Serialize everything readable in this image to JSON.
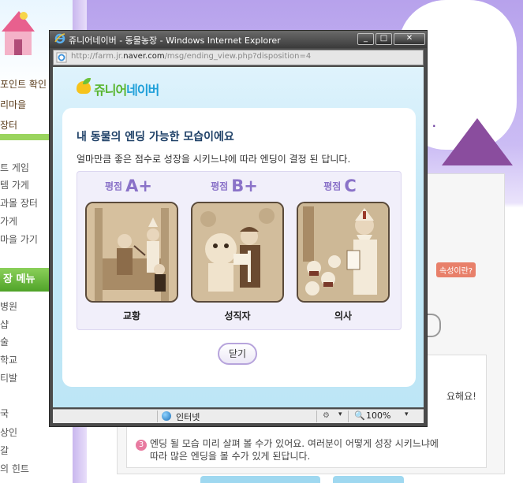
{
  "background": {
    "left_links": [
      "포인트 확인",
      "리마을",
      "장터"
    ],
    "left_items": [
      "트 게임",
      "템 가게",
      "과몰 장터",
      "가게",
      "마을 가기"
    ],
    "menu_label": "장 메뉴",
    "menu_items": [
      "병원",
      "샵",
      "술",
      "학교",
      "티발",
      "국",
      "상인",
      "갈",
      "의 힌트"
    ],
    "tag": "속성이란?",
    "line1": "요해요!",
    "line2": "엔딩 될 모습 미리 살펴 볼 수가 있어요. 여러분이 어떻게 성장 시키느냐에",
    "line3": "따라 많은 엔딩을 볼 수가 있게 된답니다.",
    "num": "3",
    "dot": "."
  },
  "window": {
    "title": "쥬니어네이버 - 동물농장 - Windows Internet Explorer",
    "url_prefix": "http://farm.jr.",
    "url_domain": "naver.com",
    "url_suffix": "/msg/ending_view.php?disposition=4",
    "controls": {
      "minimize": "_",
      "maximize": "□",
      "close": "✕"
    }
  },
  "logo": {
    "part1": "쥬니어",
    "part2": "네이버"
  },
  "card": {
    "title": "내 동물의 엔딩 가능한 모습이에요",
    "subtitle": "얼마만큼 좋은 점수로 성장을 시키느냐에 따라 엔딩이 결정 된 답니다.",
    "grades": [
      {
        "word": "평점",
        "mark": "A+",
        "name": "교황"
      },
      {
        "word": "평점",
        "mark": "B+",
        "name": "성직자"
      },
      {
        "word": "평점",
        "mark": "C",
        "name": "의사"
      }
    ],
    "close_label": "닫기"
  },
  "status": {
    "zone": "인터넷",
    "zoom": "100%",
    "caret": "▾"
  },
  "colors": {
    "accent": "#8a72c8",
    "title": "#1d3f66",
    "content_bg": "#c4e9f8"
  }
}
